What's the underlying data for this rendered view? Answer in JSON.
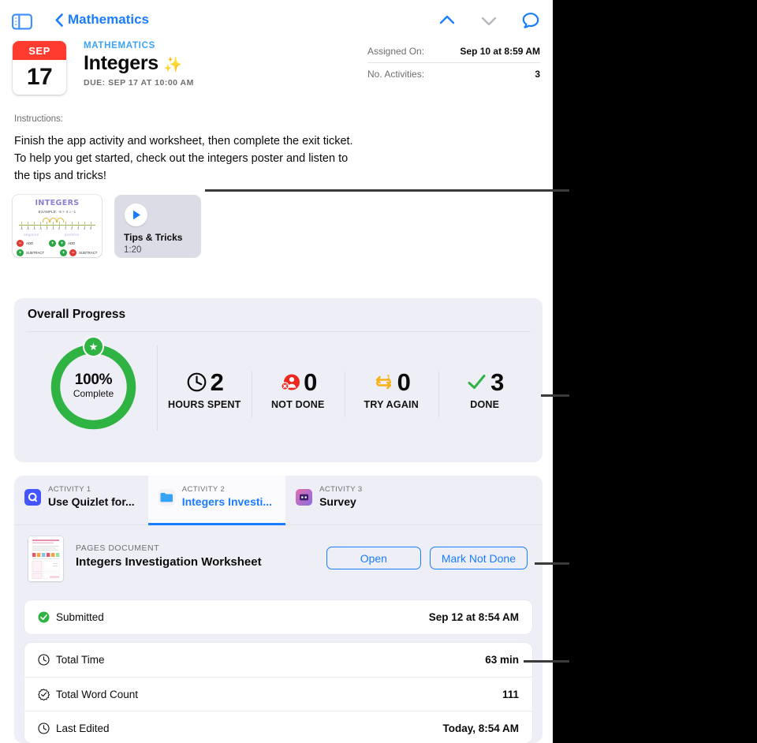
{
  "toolbar": {
    "sidebar_toggle": "sidebar-toggle",
    "back_label": "Mathematics",
    "up_icon": "chevron-up-icon",
    "down_icon": "chevron-down-icon",
    "comment_icon": "comment-bubble-icon"
  },
  "assignment": {
    "calendar_month": "SEP",
    "calendar_day": "17",
    "course": "MATHEMATICS",
    "title": "Integers",
    "title_emoji": "✨",
    "due": "DUE: SEP 17 AT 10:00 AM"
  },
  "info": {
    "rows": [
      {
        "key": "Assigned On:",
        "value": "Sep 10 at 8:59 AM"
      },
      {
        "key": "No. Activities:",
        "value": "3"
      }
    ]
  },
  "instructions": {
    "label": "Instructions:",
    "body": "Finish the app activity and worksheet, then complete the exit ticket. To help you get started, check out the integers poster and listen to the tips and tricks!"
  },
  "attachments": {
    "poster": {
      "title": "INTEGERS",
      "subtitle": "EXAMPLE:  -5 + 4 = -1",
      "left_caption": "negative",
      "right_caption": "positive",
      "rows": [
        {
          "left_sign": "−",
          "left_word": "ADD",
          "right_sign_a": "+",
          "right_sign_b": "+",
          "right_word": "ADD"
        },
        {
          "left_sign": "+",
          "left_word": "SUBTRACT",
          "right_sign_a": "+",
          "right_sign_b": "−",
          "right_word": "SUBTRACT"
        }
      ],
      "ticks": [
        "-6",
        "-5",
        "-4",
        "-3",
        "-2",
        "-1",
        "0",
        "1",
        "2",
        "3",
        "4",
        "5",
        "6"
      ]
    },
    "video": {
      "name": "Tips & Tricks",
      "duration": "1:20",
      "play_icon": "play-icon"
    }
  },
  "progress": {
    "title": "Overall Progress",
    "percent_label": "100%",
    "percent_value": 100,
    "complete_label": "Complete",
    "ring_color": "#2fb443",
    "badge_icon": "star-icon",
    "stats": [
      {
        "icon": "clock-icon",
        "value": "2",
        "label": "HOURS SPENT",
        "color": "#0b0b0b"
      },
      {
        "icon": "person-x-icon",
        "value": "0",
        "label": "NOT DONE",
        "color": "#f0271f"
      },
      {
        "icon": "loop-one-icon",
        "value": "0",
        "label": "TRY AGAIN",
        "color": "#f5b115"
      },
      {
        "icon": "checkmark-icon",
        "value": "3",
        "label": "DONE",
        "color": "#2fb443"
      }
    ]
  },
  "activities": {
    "tabs": [
      {
        "sub": "ACTIVITY 1",
        "name": "Use Quizlet for...",
        "icon": "quizlet-app-icon",
        "active": false
      },
      {
        "sub": "ACTIVITY 2",
        "name": "Integers Investi...",
        "icon": "pages-document-icon",
        "active": true
      },
      {
        "sub": "ACTIVITY 3",
        "name": "Survey",
        "icon": "survey-app-icon",
        "active": false
      }
    ],
    "document": {
      "kind": "PAGES DOCUMENT",
      "name": "Integers Investigation Worksheet",
      "open_label": "Open",
      "mark_label": "Mark Not Done"
    },
    "submitted": {
      "icon": "check-circle-icon",
      "label": "Submitted",
      "value": "Sep 12 at 8:54 AM"
    },
    "details": [
      {
        "icon": "clock-icon",
        "label": "Total Time",
        "value": "63 min"
      },
      {
        "icon": "word-count-icon",
        "label": "Total Word Count",
        "value": "111"
      },
      {
        "icon": "clock-icon",
        "label": "Last Edited",
        "value": "Today, 8:54 AM"
      }
    ]
  },
  "callouts": {
    "lines": [
      {
        "name": "callout-line-attachments"
      },
      {
        "name": "callout-line-progress"
      },
      {
        "name": "callout-line-mark-not-done"
      },
      {
        "name": "callout-line-total-time"
      }
    ]
  }
}
